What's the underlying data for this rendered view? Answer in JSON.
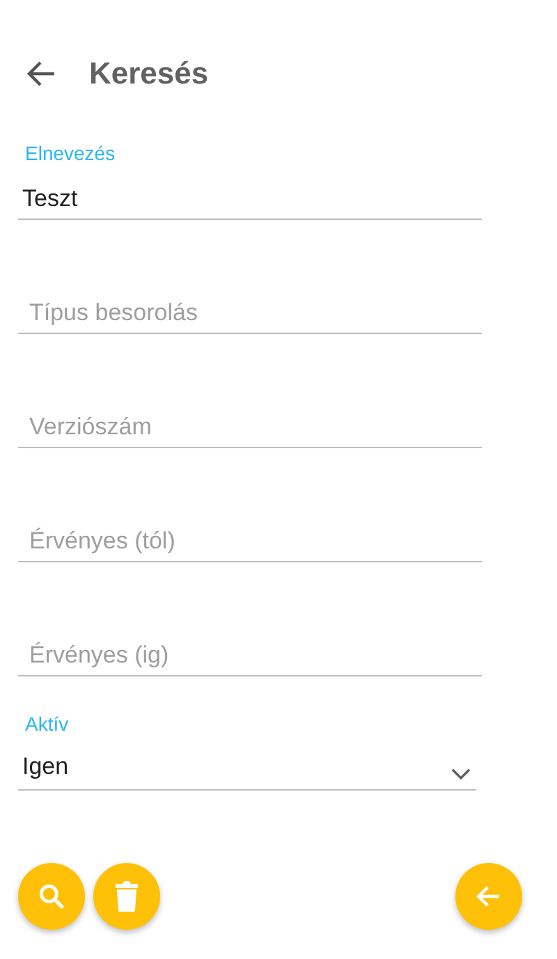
{
  "header": {
    "title": "Keresés"
  },
  "fields": [
    {
      "kind": "text",
      "label": "Elnevezés",
      "value": "Teszt"
    },
    {
      "kind": "text",
      "placeholder": "Típus besorolás"
    },
    {
      "kind": "text",
      "placeholder": "Verziószám"
    },
    {
      "kind": "text",
      "placeholder": "Érvényes (tól)"
    },
    {
      "kind": "text",
      "placeholder": "Érvényes (ig)"
    },
    {
      "kind": "select",
      "label": "Aktív",
      "value": "Igen"
    }
  ],
  "actions_left": [
    {
      "kind": "search"
    },
    {
      "kind": "delete"
    }
  ],
  "actions_right": [
    {
      "kind": "back"
    }
  ]
}
